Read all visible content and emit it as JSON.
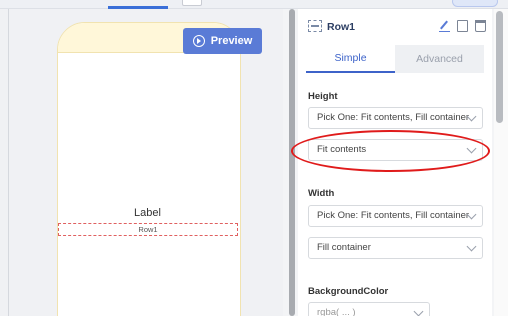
{
  "canvas": {
    "preview_label": "Preview",
    "label_text": "Label",
    "row_text": "Row1"
  },
  "panel": {
    "title": "Row1",
    "tabs": [
      {
        "label": "Simple",
        "active": true
      },
      {
        "label": "Advanced",
        "active": false
      }
    ],
    "height": {
      "label": "Height",
      "pick_one": "Pick One: Fit contents, Fill container",
      "value": "Fit contents"
    },
    "width": {
      "label": "Width",
      "pick_one": "Pick One: Fit contents, Fill container",
      "value": "Fill container"
    },
    "background": {
      "label": "BackgroundColor",
      "value": "rgba( ... )"
    }
  },
  "colors": {
    "accent": "#5a7bd6",
    "highlight": "#e01b1b",
    "selection_outline": "#e06060"
  }
}
